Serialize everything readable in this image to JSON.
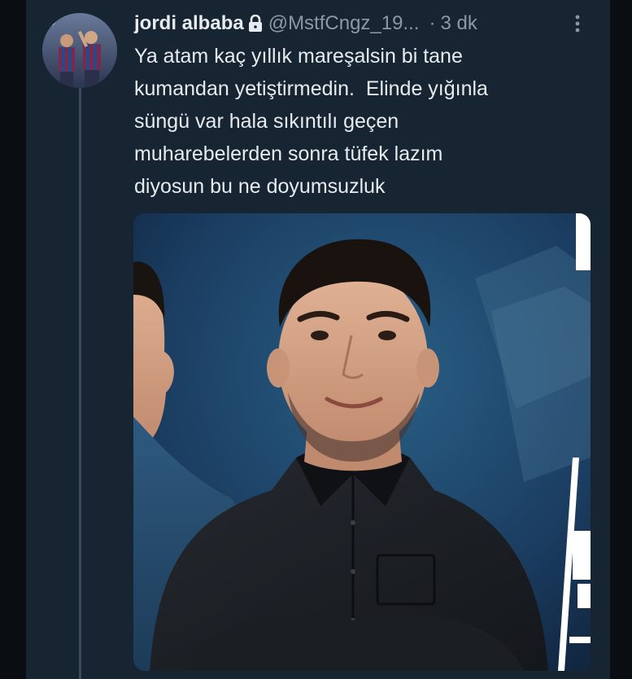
{
  "tweet": {
    "author_name": "jordi albaba",
    "handle": "@MstfCngz_19...",
    "separator": "·",
    "timestamp": "3 dk",
    "text": "Ya atam kaç yıllık mareşalsin bi tane\nkumandan yetiştirmedin.  Elinde yığınla\nsüngü var hala sıkıntılı geçen\nmuharebelerden sonra tüfek lazım\ndiyosun bu ne doyumsuzluk",
    "icons": {
      "lock": "lock-icon",
      "more": "more-vertical-icon"
    }
  },
  "colors": {
    "background": "#172533",
    "text_primary": "#e7ebef",
    "text_secondary": "#8b98a5"
  }
}
